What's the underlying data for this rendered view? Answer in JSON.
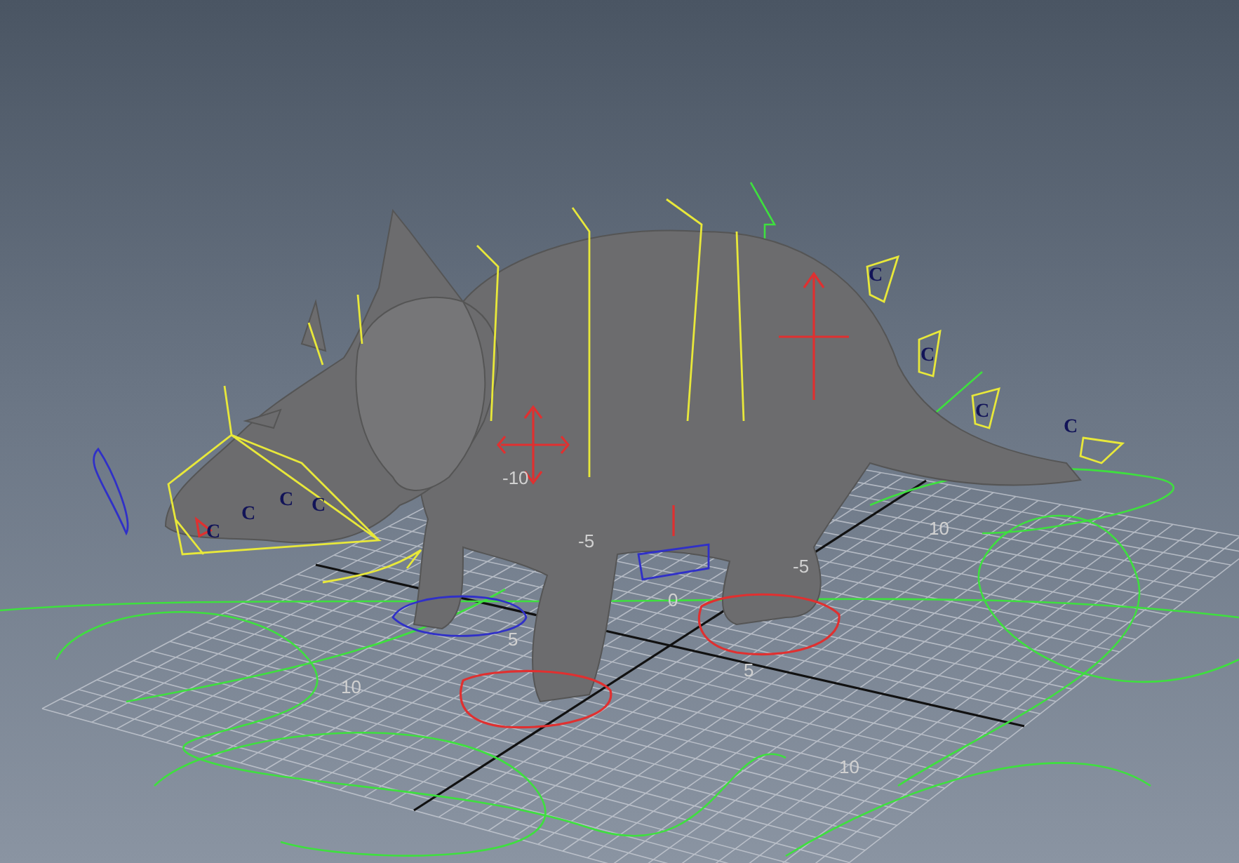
{
  "viewport": {
    "grid_labels": [
      "-10",
      "10",
      "-5",
      "-5",
      "0",
      "5",
      "5",
      "10",
      "10"
    ],
    "control_labels": [
      "C",
      "C",
      "C",
      "C",
      "C",
      "C",
      "C",
      "C"
    ]
  }
}
